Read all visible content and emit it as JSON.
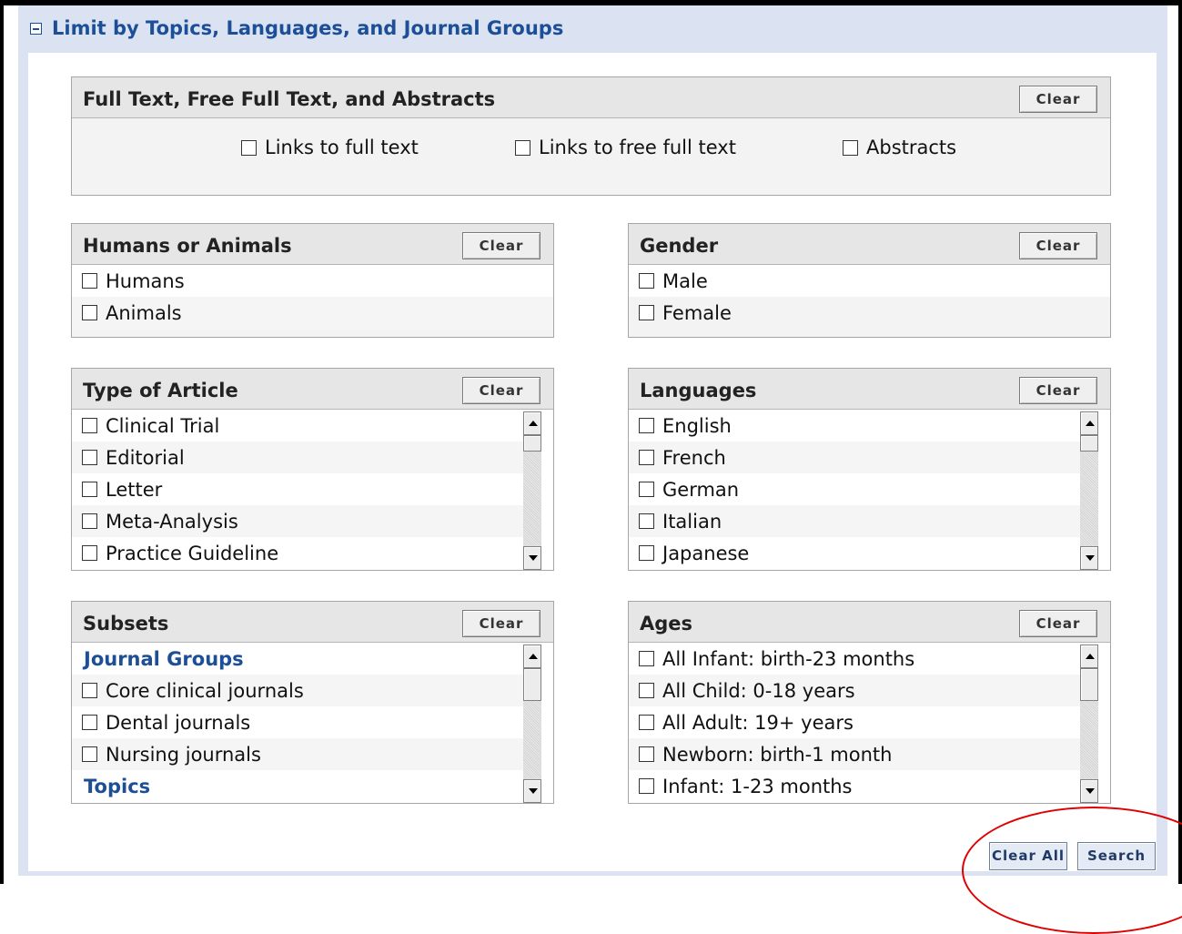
{
  "section": {
    "title": "Limit by Topics, Languages, and Journal Groups",
    "toggle_icon": "collapse-minus-icon"
  },
  "clear_label": "Clear",
  "fulltext": {
    "title": "Full Text, Free Full Text, and Abstracts",
    "options": [
      "Links to full text",
      "Links to free full text",
      "Abstracts"
    ]
  },
  "humans_animals": {
    "title": "Humans or Animals",
    "items": [
      "Humans",
      "Animals"
    ]
  },
  "gender": {
    "title": "Gender",
    "items": [
      "Male",
      "Female"
    ]
  },
  "article_type": {
    "title": "Type of Article",
    "items": [
      "Clinical Trial",
      "Editorial",
      "Letter",
      "Meta-Analysis",
      "Practice Guideline"
    ]
  },
  "languages": {
    "title": "Languages",
    "items": [
      "English",
      "French",
      "German",
      "Italian",
      "Japanese"
    ]
  },
  "subsets": {
    "title": "Subsets",
    "group_label": "Journal Groups",
    "items": [
      "Core clinical journals",
      "Dental journals",
      "Nursing journals"
    ],
    "next_group_label": "Topics"
  },
  "ages": {
    "title": "Ages",
    "items": [
      "All Infant: birth-23 months",
      "All Child: 0-18 years",
      "All Adult: 19+ years",
      "Newborn: birth-1 month",
      "Infant: 1-23 months"
    ]
  },
  "footer": {
    "clear_all_label": "Clear All",
    "search_label": "Search"
  },
  "colors": {
    "accent": "#1d4f96",
    "annotation": "#e00000"
  }
}
